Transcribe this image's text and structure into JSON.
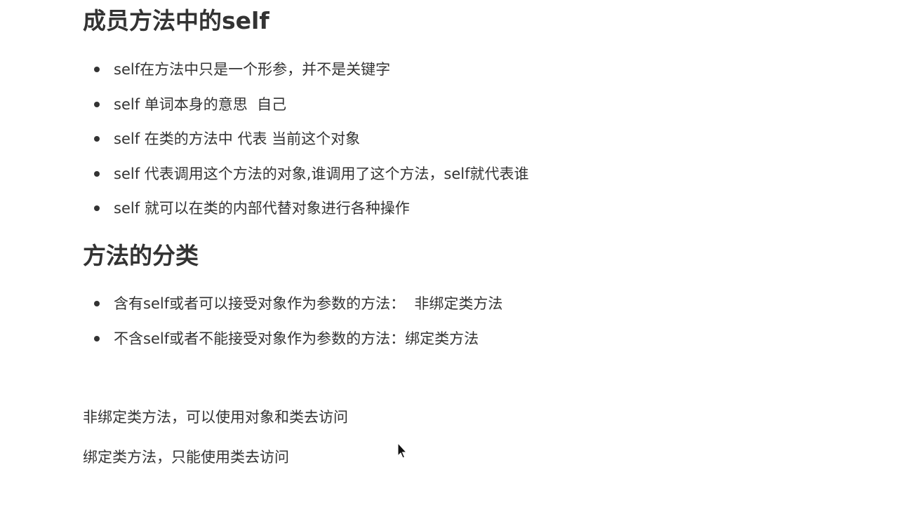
{
  "section_self": {
    "heading": "成员方法中的self",
    "items": [
      "self在方法中只是一个形参，并不是关键字",
      "self 单词本身的意思  自己",
      "self 在类的方法中 代表 当前这个对象",
      "self 代表调用这个方法的对象,谁调用了这个方法，self就代表谁",
      "self 就可以在类的内部代替对象进行各种操作"
    ]
  },
  "section_categories": {
    "heading": "方法的分类",
    "items": [
      "含有self或者可以接受对象作为参数的方法：  非绑定类方法",
      "不含self或者不能接受对象作为参数的方法：绑定类方法"
    ]
  },
  "notes": [
    "非绑定类方法，可以使用对象和类去访问",
    "绑定类方法，只能使用类去访问"
  ],
  "colors": {
    "text": "#333333",
    "background": "#ffffff"
  }
}
